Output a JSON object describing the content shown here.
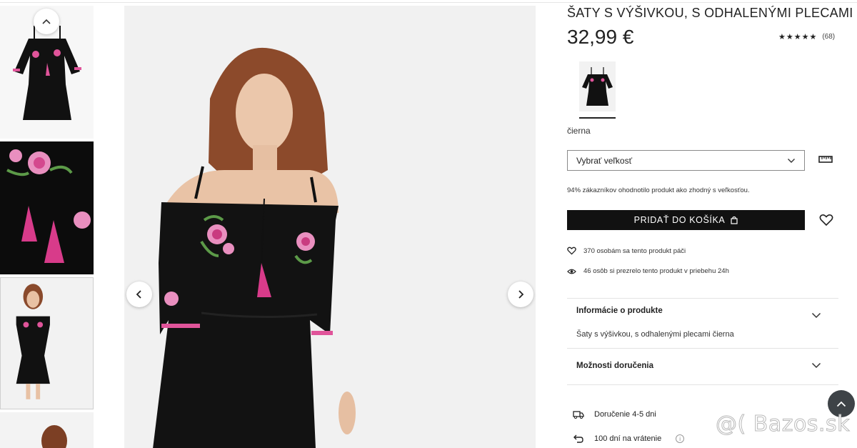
{
  "product": {
    "title": "ŠATY S VÝŠIVKOU, S ODHALENÝMI PLECAMI",
    "price": "32,99 €",
    "rating_stars": "★★★★★",
    "rating_count": "(68)",
    "color_name": "čierna"
  },
  "size": {
    "placeholder": "Vybrať veľkosť",
    "fit_note": "94% zákazníkov ohodnotilo produkt ako zhodný s veľkosťou."
  },
  "cart": {
    "add_label": "PRIDAŤ DO KOŠÍKA"
  },
  "social": {
    "likes": "370 osobám sa tento produkt páči",
    "views": "46 osôb si prezrelo tento produkt v priebehu 24h"
  },
  "accordion": {
    "info_title": "Informácie o produkte",
    "info_body": "Šaty s výšivkou, s odhalenými plecami čierna",
    "delivery_title": "Možnosti doručenia"
  },
  "delivery": {
    "time": "Doručenie 4-5 dni",
    "returns": "100 dní na vrátenie"
  },
  "watermark": "@( Bazos.sk",
  "icons": {
    "thumbs_up": "chevron-up-icon",
    "prev": "chevron-left-icon",
    "next": "chevron-right-icon",
    "select": "chevron-down-icon",
    "ruler": "ruler-icon",
    "bag": "bag-icon",
    "wishlist": "heart-icon",
    "likes": "heart-icon",
    "views": "eye-icon",
    "truck": "truck-icon",
    "return": "return-arrow-icon",
    "info": "info-icon",
    "scroll_top": "chevron-up-icon"
  },
  "colors": {
    "button_bg": "#111111",
    "dress": "#111111",
    "embroidery_pink": "#e0549a",
    "scroll_btn": "#3e4347"
  }
}
